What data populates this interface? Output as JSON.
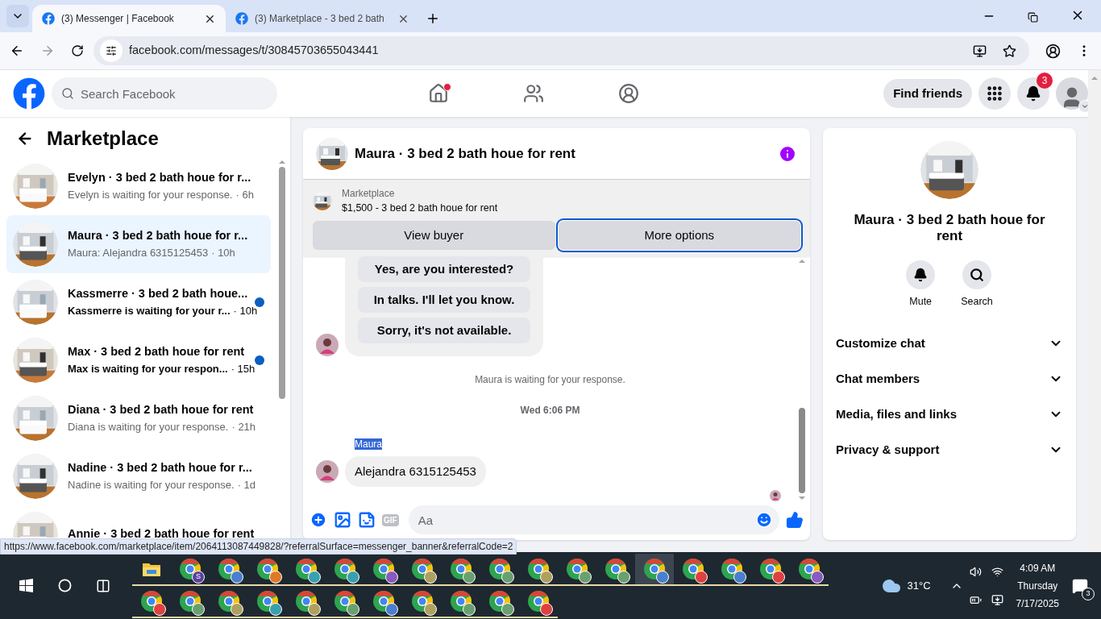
{
  "browser": {
    "tabs": [
      {
        "title": "(3) Messenger | Facebook",
        "selected": true
      },
      {
        "title": "(3) Marketplace - 3 bed 2 bath",
        "selected": false
      }
    ],
    "url": "facebook.com/messages/t/30845703655043441"
  },
  "header": {
    "search_placeholder": "Search Facebook",
    "nav": [
      {
        "kind": "home",
        "dot": true
      },
      {
        "kind": "friends",
        "dot": false
      },
      {
        "kind": "groups",
        "dot": false
      }
    ],
    "find_friends": "Find friends",
    "notification_count": "3"
  },
  "sidebar": {
    "title": "Marketplace",
    "conversations": [
      {
        "title": "Evelyn · 3 bed 2 bath houe for r...",
        "preview": "Evelyn is waiting for your response.",
        "time": "· 6h",
        "selected": false,
        "unread": false
      },
      {
        "title": "Maura · 3 bed 2 bath houe for r...",
        "preview": "Maura: Alejandra 6315125453",
        "time": "· 10h",
        "selected": true,
        "unread": false
      },
      {
        "title": "Kassmerre · 3 bed 2 bath houe...",
        "preview": "Kassmerre is waiting for your r...",
        "time": "· 10h",
        "selected": false,
        "unread": true
      },
      {
        "title": "Max · 3 bed 2 bath houe for rent",
        "preview": "Max is waiting for your respon...",
        "time": "· 15h",
        "selected": false,
        "unread": true
      },
      {
        "title": "Diana · 3 bed 2 bath houe for rent",
        "preview": "Diana is waiting for your response.",
        "time": "· 21h",
        "selected": false,
        "unread": false
      },
      {
        "title": "Nadine · 3 bed 2 bath houe for r...",
        "preview": "Nadine is waiting for your response.",
        "time": "· 1d",
        "selected": false,
        "unread": false
      },
      {
        "title": "Annie · 3 bed 2 bath houe for rent",
        "selected": false,
        "unread": false
      }
    ]
  },
  "chat": {
    "title": "Maura · 3 bed 2 bath houe for rent",
    "listing": {
      "source": "Marketplace",
      "title": "$1,500 - 3 bed 2 bath houe for rent"
    },
    "buttons": [
      {
        "label": "View buyer",
        "focused": false
      },
      {
        "label": "More options",
        "focused": true
      }
    ],
    "quick_replies": [
      "Yes, are you interested?",
      "In talks. I'll let you know.",
      "Sorry, it's not available."
    ],
    "status_text": "Maura is waiting for your response.",
    "timestamp": "Wed 6:06 PM",
    "sender_name": "Maura",
    "sender_name_selected": true,
    "message": "Alejandra 6315125453",
    "gif_label": "GIF",
    "composer_placeholder": "Aa"
  },
  "details": {
    "title": "Maura · 3 bed 2 bath houe for rent",
    "actions": [
      {
        "kind": "mute",
        "label": "Mute"
      },
      {
        "kind": "search",
        "label": "Search"
      }
    ],
    "sections": [
      "Customize chat",
      "Chat members",
      "Media, files and links",
      "Privacy & support"
    ]
  },
  "status_url": "https://www.facebook.com/marketplace/item/2064113087449828/?referralSurface=messenger_banner&referralCode=2",
  "taskbar": {
    "apps": [
      {
        "kind": "folder",
        "selected": false
      },
      {
        "kind": "chrome",
        "color": "#5b3fa0",
        "badge": "S",
        "selected": false
      },
      {
        "kind": "chrome",
        "color": "#4a7fd0",
        "selected": false
      },
      {
        "kind": "chrome",
        "color": "#e0782a",
        "selected": false
      },
      {
        "kind": "chrome",
        "color": "#3aa0b0",
        "selected": false
      },
      {
        "kind": "chrome",
        "color": "#3aa0b0",
        "selected": false
      },
      {
        "kind": "chrome",
        "color": "#8a5ac0",
        "selected": false
      },
      {
        "kind": "chrome",
        "color": "#b0a060",
        "selected": false
      },
      {
        "kind": "chrome",
        "color": "#6aa070",
        "selected": false
      },
      {
        "kind": "chrome",
        "color": "#6aa070",
        "selected": false
      },
      {
        "kind": "chrome",
        "color": "#b0a060",
        "selected": false
      },
      {
        "kind": "chrome",
        "color": "#6aa070",
        "selected": false
      },
      {
        "kind": "chrome",
        "color": "#6aa070",
        "selected": false
      },
      {
        "kind": "chrome",
        "color": "#4a7fd0",
        "selected": true
      },
      {
        "kind": "chrome",
        "color": "#e04040",
        "selected": false
      },
      {
        "kind": "chrome",
        "color": "#4a7fd0",
        "selected": false
      },
      {
        "kind": "chrome",
        "color": "#e04040",
        "selected": false
      },
      {
        "kind": "chrome",
        "color": "#8a5ac0",
        "selected": false
      },
      {
        "kind": "chrome",
        "color": "#e04040",
        "selected": false
      },
      {
        "kind": "chrome",
        "color": "#6aa070",
        "selected": false
      },
      {
        "kind": "chrome",
        "color": "#b0a060",
        "selected": false
      },
      {
        "kind": "chrome",
        "color": "#3aa0b0",
        "selected": false
      },
      {
        "kind": "chrome",
        "color": "#b0a060",
        "selected": false
      },
      {
        "kind": "chrome",
        "color": "#6aa070",
        "selected": false
      },
      {
        "kind": "chrome",
        "color": "#4a7fd0",
        "selected": false
      },
      {
        "kind": "chrome",
        "color": "#b0a060",
        "selected": false
      },
      {
        "kind": "chrome",
        "color": "#6aa070",
        "selected": false
      },
      {
        "kind": "chrome",
        "color": "#6aa070",
        "selected": false
      },
      {
        "kind": "chrome",
        "color": "#e04040",
        "selected": false
      }
    ],
    "weather": "31°C",
    "time": "4:09 AM",
    "day": "Thursday",
    "date": "7/17/2025",
    "notification_count": "3"
  }
}
